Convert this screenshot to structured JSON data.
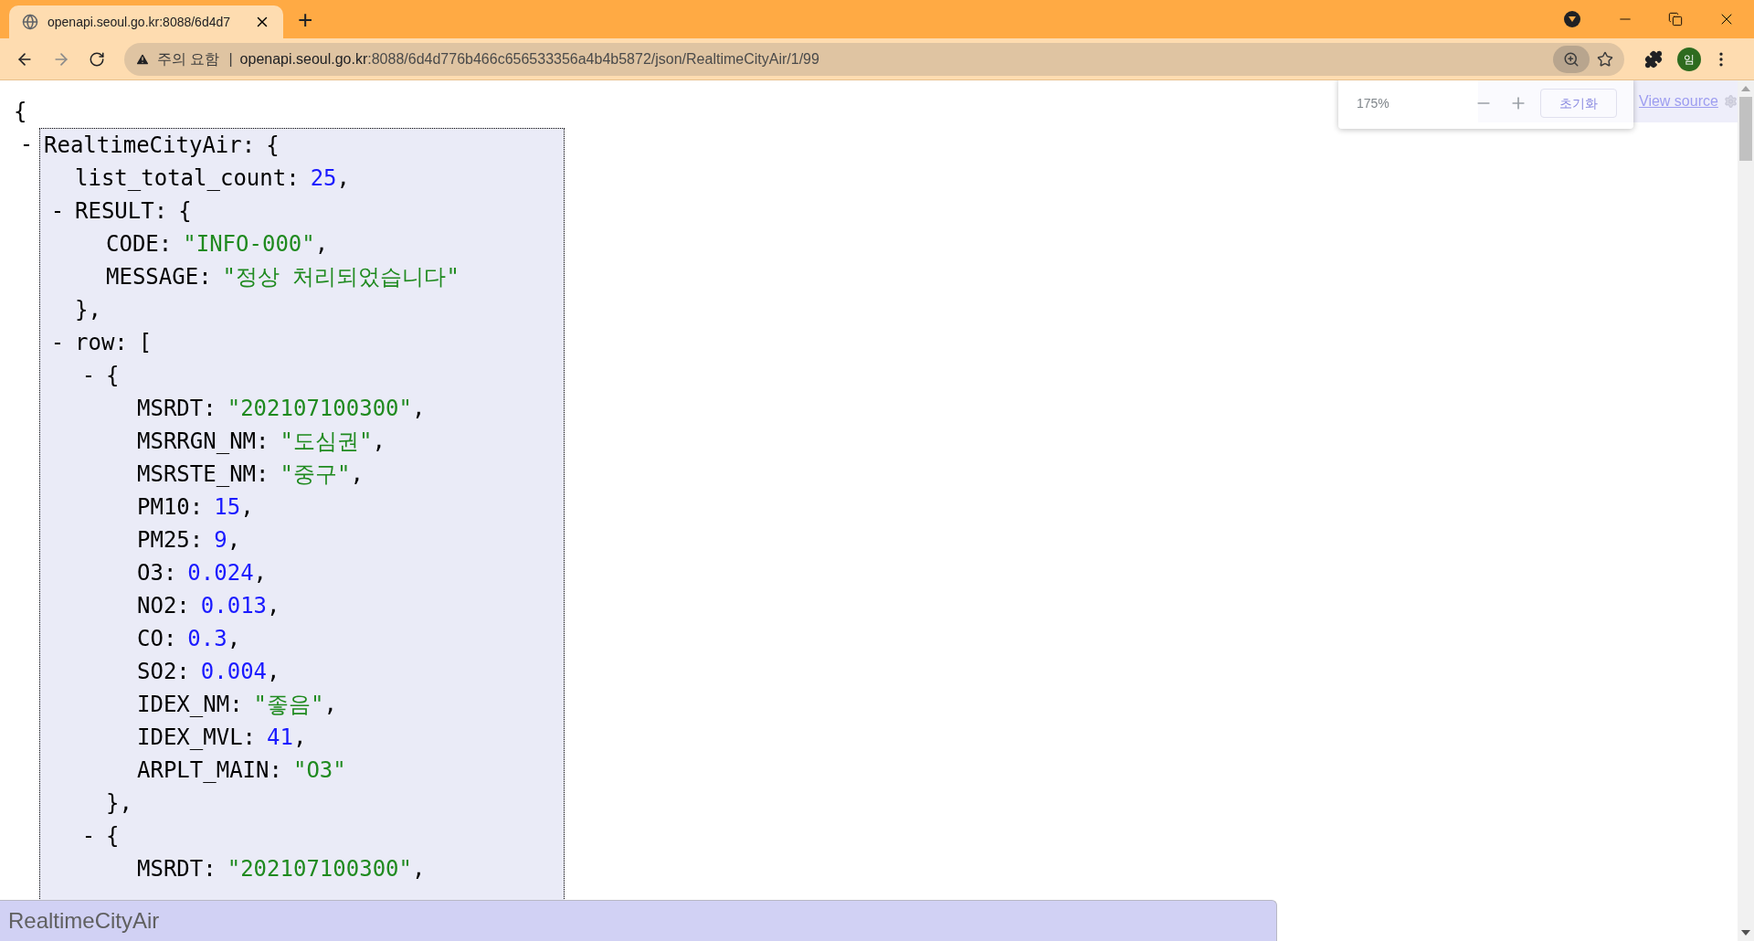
{
  "browser": {
    "tab": {
      "title": "openapi.seoul.go.kr:8088/6d4d7",
      "selected": true
    },
    "new_tab": "+",
    "address": {
      "warning": "주의 요함",
      "separator": "|",
      "host": "openapi.seoul.go.kr",
      "path": ":8088/6d4d776b466c656533356a4b4b5872/json/RealtimeCityAir/1/99"
    },
    "profile": "임"
  },
  "zoom_popup": {
    "level": "175%",
    "reset": "초기화"
  },
  "view_source": "View source",
  "viewer": {
    "open": "{",
    "nodes": [
      {
        "toggle": "-",
        "highlighted": true,
        "key": "RealtimeCityAir:",
        "open": "{",
        "children": [
          {
            "key": "list_total_count:",
            "value": "25",
            "kind": "number",
            "trail": ","
          },
          {
            "toggle": "-",
            "key": "RESULT:",
            "open": "{",
            "children": [
              {
                "key": "CODE:",
                "value": "\"INFO-000\"",
                "kind": "string",
                "trail": ","
              },
              {
                "key": "MESSAGE:",
                "value": "\"정상 처리되었습니다\"",
                "kind": "string"
              }
            ],
            "close": "},"
          },
          {
            "toggle": "-",
            "key": "row:",
            "open": "[",
            "children": [
              {
                "toggle": "-",
                "open": "{",
                "children": [
                  {
                    "key": "MSRDT:",
                    "value": "\"202107100300\"",
                    "kind": "string",
                    "trail": ","
                  },
                  {
                    "key": "MSRRGN_NM:",
                    "value": "\"도심권\"",
                    "kind": "string",
                    "trail": ","
                  },
                  {
                    "key": "MSRSTE_NM:",
                    "value": "\"중구\"",
                    "kind": "string",
                    "trail": ","
                  },
                  {
                    "key": "PM10:",
                    "value": "15",
                    "kind": "number",
                    "trail": ","
                  },
                  {
                    "key": "PM25:",
                    "value": "9",
                    "kind": "number",
                    "trail": ","
                  },
                  {
                    "key": "O3:",
                    "value": "0.024",
                    "kind": "number",
                    "trail": ","
                  },
                  {
                    "key": "NO2:",
                    "value": "0.013",
                    "kind": "number",
                    "trail": ","
                  },
                  {
                    "key": "CO:",
                    "value": "0.3",
                    "kind": "number",
                    "trail": ","
                  },
                  {
                    "key": "SO2:",
                    "value": "0.004",
                    "kind": "number",
                    "trail": ","
                  },
                  {
                    "key": "IDEX_NM:",
                    "value": "\"좋음\"",
                    "kind": "string",
                    "trail": ","
                  },
                  {
                    "key": "IDEX_MVL:",
                    "value": "41",
                    "kind": "number",
                    "trail": ","
                  },
                  {
                    "key": "ARPLT_MAIN:",
                    "value": "\"O3\"",
                    "kind": "string"
                  }
                ],
                "close": "},"
              },
              {
                "toggle": "-",
                "open": "{",
                "children": [
                  {
                    "key": "MSRDT:",
                    "value": "\"202107100300\"",
                    "kind": "string",
                    "trail": ","
                  }
                ]
              }
            ]
          }
        ]
      }
    ]
  },
  "status_bar": "RealtimeCityAir"
}
